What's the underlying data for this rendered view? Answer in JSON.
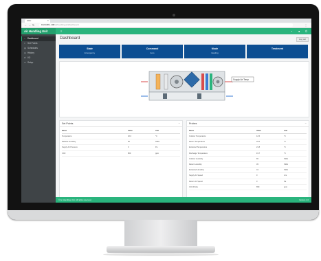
{
  "browser": {
    "tab_title": "AHU",
    "url_host": "192.168.1.100",
    "url_path": "/airhandlingunit/dashboard"
  },
  "app": {
    "brand": "Air Handling Unit",
    "page_title": "Dashboard",
    "logout_label": "Log out"
  },
  "sidebar": {
    "items": [
      {
        "label": "Dashboard",
        "icon": "home-icon"
      },
      {
        "label": "Set Points",
        "icon": "sliders-icon"
      },
      {
        "label": "Schedules",
        "icon": "calendar-icon"
      },
      {
        "label": "History",
        "icon": "chart-icon"
      },
      {
        "label": "I/O",
        "icon": "plug-icon"
      },
      {
        "label": "Setup",
        "icon": "gear-icon"
      }
    ]
  },
  "cards": [
    {
      "title": "State",
      "value": "Emergency"
    },
    {
      "title": "Command",
      "value": "Auto"
    },
    {
      "title": "Mode",
      "value": "Heating"
    },
    {
      "title": "Treatment",
      "value": ""
    }
  ],
  "diagram": {
    "tooltip": "Supply Air Temp"
  },
  "setpoints": {
    "title": "Set Points",
    "columns": [
      "Name",
      "Value",
      "Unit"
    ],
    "rows": [
      [
        "Temperature",
        "20.0",
        "°C"
      ],
      [
        "Relative Humidity",
        "50",
        "%RH"
      ],
      [
        "Supply Air Pressure",
        "0",
        "Pa"
      ],
      [
        "CO2",
        "800",
        "ppm"
      ]
    ]
  },
  "probes": {
    "title": "Probes",
    "columns": [
      "Name",
      "Value",
      "Unit"
    ],
    "rows": [
      [
        "Outdoor Temperature",
        "12.5",
        "°C"
      ],
      [
        "Return Temperature",
        "22.0",
        "°C"
      ],
      [
        "Extracted Temperature",
        "21.8",
        "°C"
      ],
      [
        "Discharge Temperature",
        "19.7",
        "°C"
      ],
      [
        "Outdoor Humidity",
        "65",
        "%RH"
      ],
      [
        "Return Humidity",
        "45",
        "%RH"
      ],
      [
        "Extracted Humidity",
        "44",
        "%RH"
      ],
      [
        "Supply Air Speed",
        "0",
        "m/s"
      ],
      [
        "Return Air Speed",
        "0",
        "Pa"
      ],
      [
        "CO2 Probe",
        "650",
        "ppm"
      ]
    ]
  },
  "footer": {
    "left": "© Air Handling Unit. All rights reserved.",
    "right": "Version 1.0"
  },
  "colors": {
    "accent": "#2ab47d",
    "card": "#0c4e92",
    "sidebar": "#3f4447"
  }
}
